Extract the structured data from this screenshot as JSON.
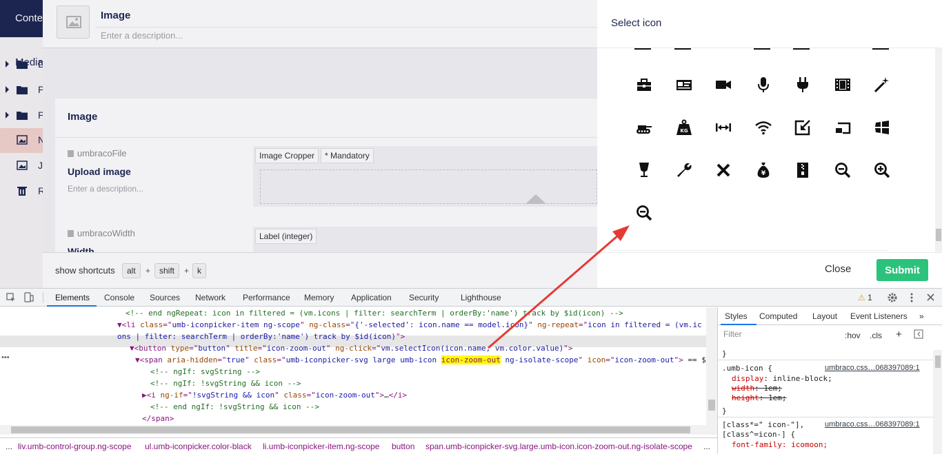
{
  "app": {
    "brand": "Conte",
    "section_title": "Media"
  },
  "tree": [
    {
      "label": "D",
      "icon": "folder-icon"
    },
    {
      "label": "P",
      "icon": "folder-icon"
    },
    {
      "label": "P",
      "icon": "folder-icon"
    },
    {
      "label": "N",
      "icon": "image-icon"
    },
    {
      "label": "J",
      "icon": "image-icon"
    },
    {
      "label": "R",
      "icon": "trash-icon"
    }
  ],
  "editor": {
    "name": "Image",
    "description_placeholder": "Enter a description...",
    "group_title": "Image",
    "properties": [
      {
        "alias": "umbracoFile",
        "label": "Upload image",
        "description": "Enter a description...",
        "tags": [
          "Image Cropper",
          "* Mandatory"
        ]
      },
      {
        "alias": "umbracoWidth",
        "label": "Width",
        "tags": [
          "Label (integer)"
        ]
      }
    ]
  },
  "shortcuts": {
    "label": "show shortcuts",
    "keys": [
      "alt",
      "shift",
      "k"
    ],
    "plus": "+"
  },
  "dialog": {
    "title": "Select icon",
    "close_label": "Close",
    "submit_label": "Submit",
    "icon_rows": [
      [
        "toolbox-icon",
        "id-card-icon",
        "video-camera-icon",
        "microphone-icon",
        "plug-icon",
        "film-icon",
        "magic-wand-icon"
      ],
      [
        "tank-icon",
        "weight-kg-icon",
        "width-arrows-icon",
        "wifi-icon",
        "window-popin-icon",
        "window-sizes-icon",
        "windows-logo-icon"
      ],
      [
        "wine-glass-icon",
        "wrench-icon",
        "wrong-icon",
        "yen-bag-icon",
        "zip-icon",
        "zoom-out-icon",
        "zoom-in-icon"
      ],
      [
        "zoom-out-icon"
      ]
    ]
  },
  "devtools": {
    "tabs": [
      "Elements",
      "Console",
      "Sources",
      "Network",
      "Performance",
      "Memory",
      "Application",
      "Security",
      "Lighthouse"
    ],
    "warning_count": "1",
    "code": [
      {
        "indent": 0,
        "parts": [
          [
            "cm",
            "<!-- end ngRepeat: icon in filtered = (vm.icons | filter: searchTerm | orderBy:'name') track by $id(icon) -->"
          ]
        ]
      },
      {
        "indent": -1,
        "parts": [
          [
            "tg",
            "▼<li "
          ],
          [
            "an",
            "class"
          ],
          [
            "tg",
            "=\""
          ],
          [
            "av",
            "umb-iconpicker-item ng-scope"
          ],
          [
            "tg",
            "\" "
          ],
          [
            "an",
            "ng-class"
          ],
          [
            "tg",
            "=\""
          ],
          [
            "av",
            "{'-selected': icon.name == model.icon}"
          ],
          [
            "tg",
            "\" "
          ],
          [
            "an",
            "ng-repeat"
          ],
          [
            "tg",
            "=\""
          ],
          [
            "av",
            "icon in filtered = (vm.ic"
          ]
        ]
      },
      {
        "indent": -1,
        "parts": [
          [
            "av",
            "ons | filter: searchTerm | orderBy:'name') track by $id(icon)"
          ],
          [
            "tg",
            "\">"
          ]
        ]
      },
      {
        "indent": 1,
        "parts": [
          [
            "tg",
            "▼<button "
          ],
          [
            "an",
            "type"
          ],
          [
            "tg",
            "=\""
          ],
          [
            "av",
            "button"
          ],
          [
            "tg",
            "\" "
          ],
          [
            "an",
            "title"
          ],
          [
            "tg",
            "=\""
          ],
          [
            "av",
            "icon-zoom-out"
          ],
          [
            "tg",
            "\" "
          ],
          [
            "an",
            "ng-click"
          ],
          [
            "tg",
            "=\""
          ],
          [
            "av",
            "vm.selectIcon(icon.name, vm.color.value)"
          ],
          [
            "tg",
            "\">"
          ]
        ]
      },
      {
        "indent": 2,
        "parts": [
          [
            "tg",
            "▼<span "
          ],
          [
            "an",
            "aria-hidden"
          ],
          [
            "tg",
            "=\""
          ],
          [
            "av",
            "true"
          ],
          [
            "tg",
            "\" "
          ],
          [
            "an",
            "class"
          ],
          [
            "tg",
            "=\""
          ],
          [
            "av",
            "umb-iconpicker-svg large umb-icon "
          ],
          [
            "hl",
            "icon-zoom-out"
          ],
          [
            "av",
            " ng-isolate-scope"
          ],
          [
            "tg",
            "\" "
          ],
          [
            "an",
            "icon"
          ],
          [
            "tg",
            "=\""
          ],
          [
            "av",
            "icon-zoom-out"
          ],
          [
            "tg",
            "\">"
          ],
          [
            "txt",
            " == $"
          ]
        ]
      },
      {
        "indent": 3,
        "parts": [
          [
            "cm",
            "<!-- ngIf: svgString -->"
          ]
        ]
      },
      {
        "indent": 3,
        "parts": [
          [
            "cm",
            "<!-- ngIf: !svgString && icon -->"
          ]
        ]
      },
      {
        "indent": 2.6,
        "parts": [
          [
            "tg",
            "▶<i "
          ],
          [
            "an",
            "ng-if"
          ],
          [
            "tg",
            "=\""
          ],
          [
            "av",
            "!svgString && icon"
          ],
          [
            "tg",
            "\" "
          ],
          [
            "an",
            "class"
          ],
          [
            "tg",
            "=\""
          ],
          [
            "av",
            "icon-zoom-out"
          ],
          [
            "tg",
            "\">"
          ],
          [
            "txt",
            "…"
          ],
          [
            "tg",
            "</i>"
          ]
        ]
      },
      {
        "indent": 3,
        "parts": [
          [
            "cm",
            "<!-- end ngIf: !svgString && icon -->"
          ]
        ]
      },
      {
        "indent": 2.4,
        "parts": [
          [
            "tg",
            "</span>"
          ]
        ]
      }
    ],
    "breadcrumbs": [
      "...",
      "liv.umb-control-group.ng-scope",
      "ul.umb-iconpicker.color-black",
      "li.umb-iconpicker-item.ng-scope",
      "button",
      "span.umb-iconpicker-svg.large.umb-icon.icon-zoom-out.ng-isolate-scope",
      "..."
    ],
    "styles": {
      "tabs": [
        "Styles",
        "Computed",
        "Layout",
        "Event Listeners",
        "»"
      ],
      "filter_placeholder": "Filter",
      "hov": ":hov",
      "cls": ".cls",
      "plus": "+",
      "rule1": {
        "selector": ".umb-icon {",
        "source": "umbraco.css…068397089:1",
        "props": [
          {
            "name": "display",
            "value": "inline-block;",
            "strike": false
          },
          {
            "name": "width",
            "value": "1em;",
            "strike": true
          },
          {
            "name": "height",
            "value": "1em;",
            "strike": true
          }
        ],
        "close": "}"
      },
      "rule2": {
        "selector": "[class*=\" icon-\"],",
        "selector2": "[class^=icon-] {",
        "source": "umbraco.css…068397089:1",
        "prop": "font-family: icomoon;"
      },
      "prev_close": "}"
    }
  },
  "colors": {
    "submit": "#2bc37c",
    "nav": "#1b264f",
    "highlight": "#fffa00",
    "arrow": "#e53935"
  }
}
